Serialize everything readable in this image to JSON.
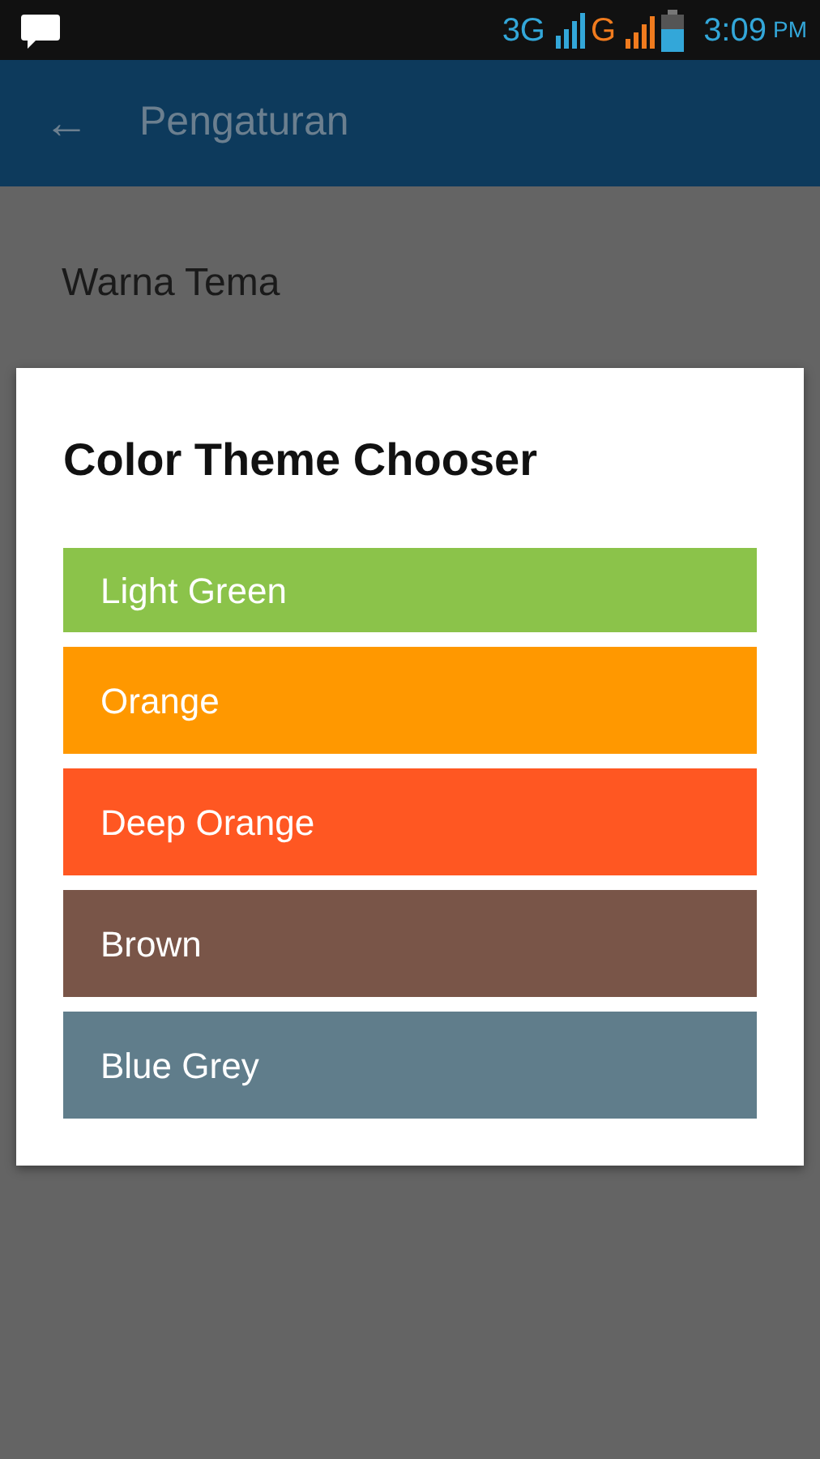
{
  "status_bar": {
    "network_1": "3G",
    "network_2": "G",
    "time": "3:09",
    "meridiem": "PM"
  },
  "app_bar": {
    "back": "←",
    "title": "Pengaturan"
  },
  "settings": [
    {
      "label": "Warna Tema"
    }
  ],
  "dialog": {
    "title": "Color Theme Chooser",
    "options": [
      {
        "label": "Light Green",
        "color": "#8bc34a",
        "clipped": true
      },
      {
        "label": "Orange",
        "color": "#ff9800",
        "clipped": false
      },
      {
        "label": "Deep Orange",
        "color": "#ff5722",
        "clipped": false
      },
      {
        "label": "Brown",
        "color": "#795548",
        "clipped": false
      },
      {
        "label": "Blue Grey",
        "color": "#607d8b",
        "clipped": false
      }
    ]
  }
}
